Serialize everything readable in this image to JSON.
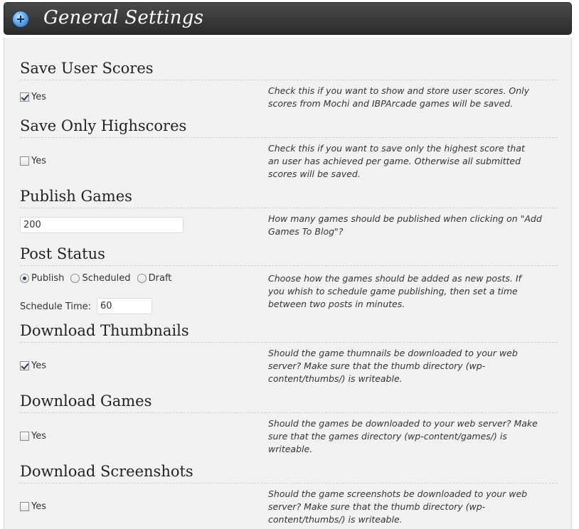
{
  "header": {
    "title": "General Settings",
    "icon": "plus-circle-icon"
  },
  "checkbox_label": "Yes",
  "sections": {
    "save_user_scores": {
      "title": "Save User Scores",
      "checked": true,
      "desc_lines": [
        "Check this if you want to show and store user scores. Only",
        "scores from Mochi and IBPArcade games will be saved."
      ]
    },
    "save_only_highscores": {
      "title": "Save Only Highscores",
      "checked": false,
      "desc_lines": [
        "Check this if you want to save only the highest score that",
        "an user has achieved per game. Otherwise all submitted",
        "scores will be saved."
      ]
    },
    "publish_games": {
      "title": "Publish Games",
      "value": "200",
      "desc_lines": [
        "How many games should be published when clicking on \"Add",
        "Games To Blog\"?"
      ]
    },
    "post_status": {
      "title": "Post Status",
      "options": [
        "Publish",
        "Scheduled",
        "Draft"
      ],
      "selected": "Publish",
      "schedule_label": "Schedule Time:",
      "schedule_value": "60",
      "desc_lines": [
        "Choose how the games should be added as new posts. If",
        "you whish to schedule game publishing, then set a time",
        "between two posts in minutes."
      ]
    },
    "download_thumbnails": {
      "title": "Download Thumbnails",
      "checked": true,
      "desc_lines": [
        "Should the game thumnails be downloaded to your web",
        "server? Make sure that the thumb directory (wp-",
        "content/thumbs/) is writeable."
      ]
    },
    "download_games": {
      "title": "Download Games",
      "checked": false,
      "desc_lines": [
        "Should the games be downloaded to your web server? Make",
        "sure that the games directory (wp-content/games/) is",
        "writeable."
      ]
    },
    "download_screenshots": {
      "title": "Download Screenshots",
      "checked": false,
      "desc_lines": [
        "Should the game screenshots be downloaded to your web",
        "server? Make sure that the thumb directory (wp-",
        "content/thumbs/) is writeable."
      ]
    }
  }
}
